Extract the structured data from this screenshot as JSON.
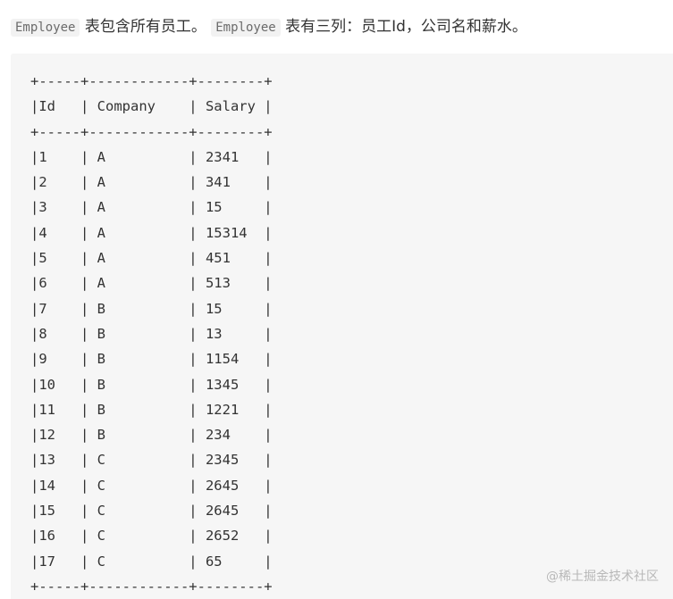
{
  "intro": {
    "code1": "Employee",
    "text1": " 表包含所有员工。",
    "code2": "Employee",
    "text2": " 表有三列：员工Id，公司名和薪水。"
  },
  "table_lines": [
    "+-----+------------+--------+",
    "|Id   | Company    | Salary |",
    "+-----+------------+--------+",
    "|1    | A          | 2341   |",
    "|2    | A          | 341    |",
    "|3    | A          | 15     |",
    "|4    | A          | 15314  |",
    "|5    | A          | 451    |",
    "|6    | A          | 513    |",
    "|7    | B          | 15     |",
    "|8    | B          | 13     |",
    "|9    | B          | 1154   |",
    "|10   | B          | 1345   |",
    "|11   | B          | 1221   |",
    "|12   | B          | 234    |",
    "|13   | C          | 2345   |",
    "|14   | C          | 2645   |",
    "|15   | C          | 2645   |",
    "|16   | C          | 2652   |",
    "|17   | C          | 65     |",
    "+-----+------------+--------+"
  ],
  "watermark": "@稀土掘金技术社区"
}
